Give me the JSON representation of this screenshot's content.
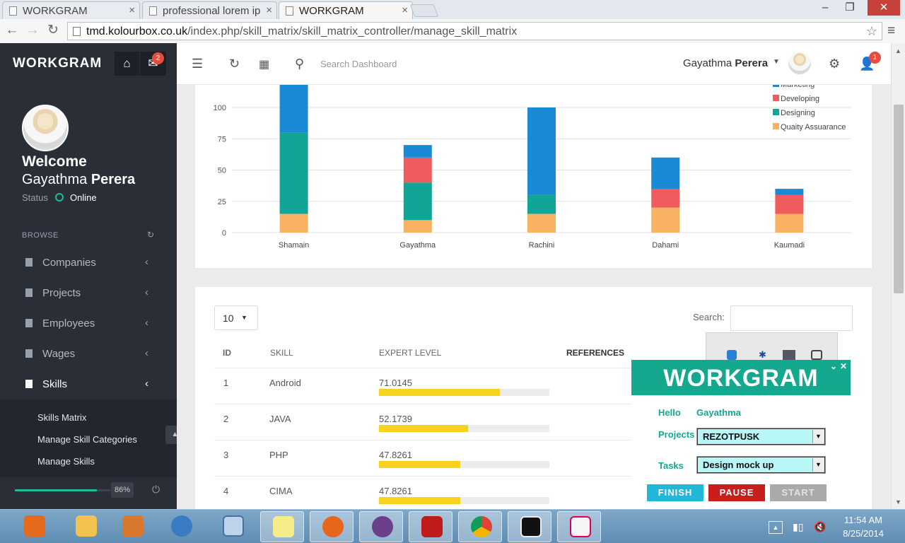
{
  "browser": {
    "tabs": [
      {
        "title": "WORKGRAM",
        "close": "×"
      },
      {
        "title": "professional lorem ip",
        "close": "×"
      },
      {
        "title": "WORKGRAM",
        "close": "×"
      }
    ],
    "window_controls": {
      "minimize": "–",
      "maximize": "❐",
      "close": "✕"
    },
    "url_host": "tmd.kolourbox.co.uk",
    "url_path": "/index.php/skill_matrix/skill_matrix_controller/manage_skill_matrix",
    "back": "←",
    "forward": "→",
    "reload": "↻",
    "star": "☆",
    "menu": "≡"
  },
  "sidebar": {
    "brand": "WORKGRAM",
    "mail_badge": "2",
    "welcome": "Welcome",
    "first_name": "Gayathma",
    "last_name": "Perera",
    "status_label": "Status",
    "status_value": "Online",
    "browse_label": "BROWSE",
    "menu": [
      {
        "label": "Companies",
        "chevron": "‹"
      },
      {
        "label": "Projects",
        "chevron": "‹"
      },
      {
        "label": "Employees",
        "chevron": "‹"
      },
      {
        "label": "Wages",
        "chevron": "‹"
      },
      {
        "label": "Skills",
        "chevron": "‹"
      }
    ],
    "submenu": [
      "Skills Matrix",
      "Manage Skill Categories",
      "Manage Skills"
    ],
    "progress_percent": "86%",
    "progress_value": 0.86
  },
  "topbar": {
    "search_placeholder": "Search Dashboard",
    "user_first": "Gayathma",
    "user_last": "Perera",
    "notification_badge": "1"
  },
  "chart_data": {
    "type": "bar",
    "stacked": true,
    "categories": [
      "Shamain",
      "Gayathma",
      "Rachini",
      "Dahami",
      "Kaumadi"
    ],
    "series": [
      {
        "name": "Quaity Assuarance",
        "color": "#f8b262",
        "values": [
          15,
          10,
          15,
          20,
          15
        ]
      },
      {
        "name": "Designing",
        "color": "#10a596",
        "values": [
          65,
          30,
          15,
          0,
          0
        ]
      },
      {
        "name": "Developing",
        "color": "#f05b5f",
        "values": [
          0,
          20,
          0,
          15,
          15
        ]
      },
      {
        "name": "Marketing",
        "color": "#1b8ad6",
        "values": [
          40,
          10,
          70,
          25,
          5
        ]
      }
    ],
    "yticks": [
      "0",
      "25",
      "50",
      "75",
      "100"
    ],
    "ylim": [
      0,
      100
    ],
    "legend_position": "top-right",
    "grid": true
  },
  "table": {
    "length_value": "10",
    "search_label": "Search:",
    "columns": [
      "ID",
      "SKILL",
      "EXPERT LEVEL",
      "REFERENCES"
    ],
    "rows": [
      {
        "id": "1",
        "skill": "Android",
        "level": "71.0145",
        "pct": 71.0145
      },
      {
        "id": "2",
        "skill": "JAVA",
        "level": "52.1739",
        "pct": 52.1739
      },
      {
        "id": "3",
        "skill": "PHP",
        "level": "47.8261",
        "pct": 47.8261
      },
      {
        "id": "4",
        "skill": "CIMA",
        "level": "47.8261",
        "pct": 47.8261
      }
    ]
  },
  "widget": {
    "logo": "WORKGRAM",
    "hello_label": "Hello",
    "hello_name": "Gayathma",
    "projects_label": "Projects",
    "project_value": "REZOTPUSK",
    "tasks_label": "Tasks",
    "task_value": "Design mock up",
    "finish": "FINISH",
    "pause": "PAUSE",
    "start": "START"
  },
  "taskbar": {
    "time": "11:54 AM",
    "date": "8/25/2014"
  }
}
